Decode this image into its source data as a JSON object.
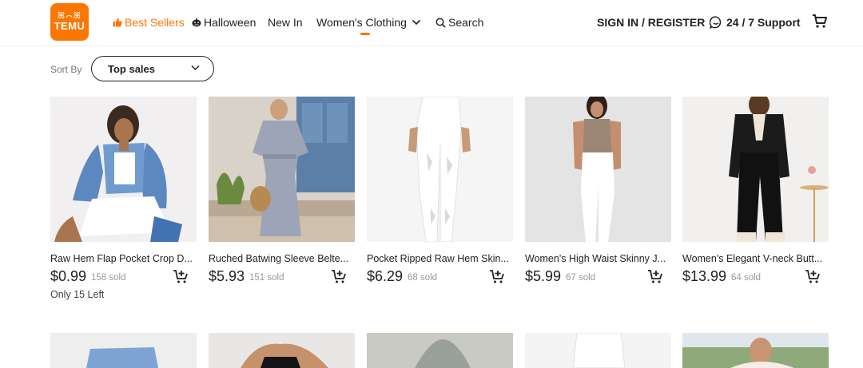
{
  "brand": {
    "name": "TEMU",
    "mark": "ꕤ⌒ꕤ",
    "color": "#fb7701"
  },
  "nav": {
    "best_sellers": "Best Sellers",
    "halloween": "Halloween",
    "new_in": "New In",
    "womens_clothing": "Women's Clothing",
    "search": "Search"
  },
  "account": {
    "sign_in": "SIGN IN / REGISTER",
    "support": "24 / 7 Support"
  },
  "sort": {
    "label": "Sort By",
    "selected": "Top sales"
  },
  "products": [
    {
      "title": "Raw Hem Flap Pocket Crop D...",
      "price": "$0.99",
      "sold": "158 sold",
      "stock": "Only 15 Left"
    },
    {
      "title": "Ruched Batwing Sleeve Belte...",
      "price": "$5.93",
      "sold": "151 sold",
      "stock": ""
    },
    {
      "title": "Pocket Ripped Raw Hem Skin...",
      "price": "$6.29",
      "sold": "68 sold",
      "stock": ""
    },
    {
      "title": "Women's High Waist Skinny J...",
      "price": "$5.99",
      "sold": "67 sold",
      "stock": ""
    },
    {
      "title": "Women's Elegant V-neck Butt...",
      "price": "$13.99",
      "sold": "64 sold",
      "stock": ""
    }
  ]
}
